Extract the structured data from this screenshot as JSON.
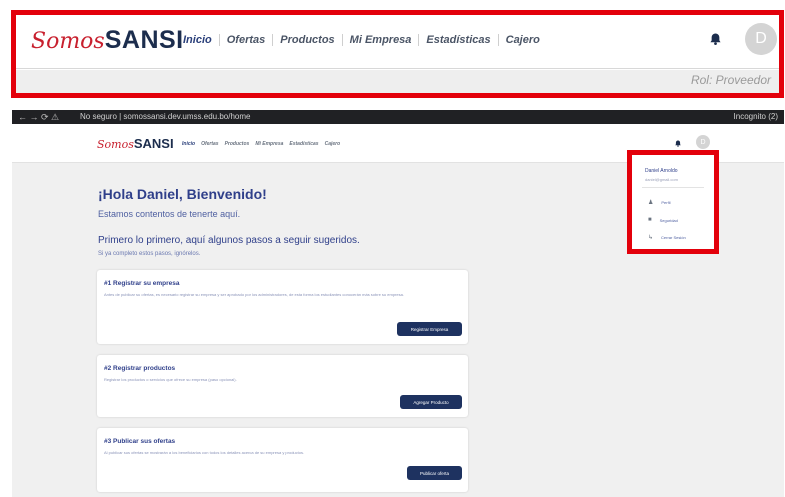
{
  "zoom_header": {
    "brand_script": "Somos",
    "brand_bold": "SANSI",
    "menu": [
      "Inicio",
      "Ofertas",
      "Productos",
      "Mi Empresa",
      "Estadísticas",
      "Cajero"
    ],
    "avatar_initial": "D",
    "role": "Rol: Proveedor"
  },
  "browser": {
    "url": "No seguro | somossansi.dev.umss.edu.bo/home",
    "incognito": "Incognito (2)"
  },
  "page": {
    "brand_script": "Somos",
    "brand_bold": "SANSI",
    "menu": [
      "Inicio",
      "Ofertas",
      "Productos",
      "Mi Empresa",
      "Estadísticas",
      "Cajero"
    ],
    "avatar_initial": "D",
    "greeting": "¡Hola Daniel, Bienvenido!",
    "welcome": "Estamos contentos de tenerte aquí.",
    "steps_heading": "Primero lo primero, aquí algunos pasos a seguir sugeridos.",
    "steps_sub": "Si ya completo estos pasos, ignórelos.",
    "cards": [
      {
        "title": "#1 Registrar su empresa",
        "desc": "Antes de publicar su ofertas, es necesario registrar su empresa y ser aprobado por los administradores, de esta forma los estudiantes conocerán más sobre su empresa.",
        "button": "Registrar Empresa"
      },
      {
        "title": "#2 Registrar productos",
        "desc": "Registrar los productos o servicios que ofrece su empresa (paso opcional).",
        "button": "Agregar Producto"
      },
      {
        "title": "#3 Publicar sus ofertas",
        "desc": "Al publicar sus ofertas se mostrarán a los beneficiarios con todos los detalles acerca de su empresa y productos.",
        "button": "Publicar oferta"
      }
    ]
  },
  "dropdown": {
    "name": "Daniel Arnoldo",
    "email": "daniel@gmail.com",
    "items": [
      {
        "label": "Perfil",
        "icon": "user-icon"
      },
      {
        "label": "Seguridad",
        "icon": "lock-icon"
      },
      {
        "label": "Cerrar Sesión",
        "icon": "logout-icon"
      }
    ]
  },
  "colors": {
    "highlight": "#e3000b",
    "brand_red": "#c8202e",
    "brand_navy": "#1c2d4d",
    "button": "#1e3260"
  }
}
